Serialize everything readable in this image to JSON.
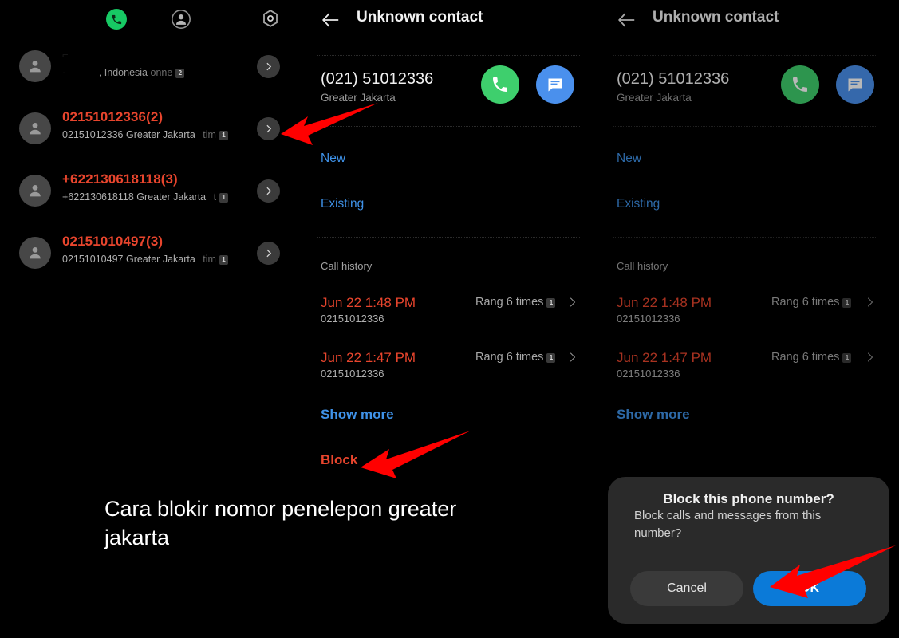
{
  "caption": "Cara blokir nomor penelepon greater jakarta",
  "colors": {
    "accent_red": "#e8452d",
    "link_blue": "#3f92e8",
    "call_green": "#3ecf6d",
    "msg_blue": "#4a90ed",
    "ok_blue": "#0b7ad8",
    "dialog_bg": "#2a2a2a",
    "annotation_red": "#ff0000",
    "background": "#000000"
  },
  "left_panel": {
    "tabs": [
      {
        "name": "phone-tab",
        "icon": "phone-icon",
        "active": true
      },
      {
        "name": "contacts-tab",
        "icon": "person-icon",
        "active": false
      },
      {
        "name": "settings-tab",
        "icon": "gear-icon",
        "active": false
      }
    ],
    "call_log": [
      {
        "title": "",
        "sub_visible": ", Indonesia",
        "sub_tail": "onne",
        "sim_badge": "2",
        "redacted": true
      },
      {
        "title": "02151012336(2)",
        "number": "02151012336",
        "location": "Greater Jakarta",
        "tail": "tim",
        "sim_badge": "1",
        "redacted": false
      },
      {
        "title": "+622130618118(3)",
        "number": "+622130618118",
        "location": "Greater Jakarta",
        "tail": "t",
        "sim_badge": "1",
        "redacted": false
      },
      {
        "title": "02151010497(3)",
        "number": "02151010497",
        "location": "Greater Jakarta",
        "tail": "tim",
        "sim_badge": "1",
        "redacted": false
      }
    ]
  },
  "detail": {
    "title": "Unknown contact",
    "back_icon": "back-arrow-icon",
    "number": "(021) 51012336",
    "location": "Greater Jakarta",
    "call_action": "call-icon",
    "message_action": "message-icon",
    "new_label": "New",
    "existing_label": "Existing",
    "call_history_label": "Call history",
    "history": [
      {
        "date": "Jun 22 1:48 PM",
        "number": "02151012336",
        "status": "Rang 6 times",
        "sim_badge": "1"
      },
      {
        "date": "Jun 22 1:47 PM",
        "number": "02151012336",
        "status": "Rang 6 times",
        "sim_badge": "1"
      }
    ],
    "show_more_label": "Show more",
    "block_label": "Block"
  },
  "dialog": {
    "title": "Block this phone number?",
    "message": "Block calls and messages from this number?",
    "cancel_label": "Cancel",
    "ok_label": "OK"
  },
  "annotations": [
    {
      "name": "arrow-to-call-log-chevron",
      "points_to": "left panel row chevron"
    },
    {
      "name": "arrow-to-block-link",
      "points_to": "Block link"
    },
    {
      "name": "arrow-to-ok-button",
      "points_to": "OK button"
    }
  ]
}
